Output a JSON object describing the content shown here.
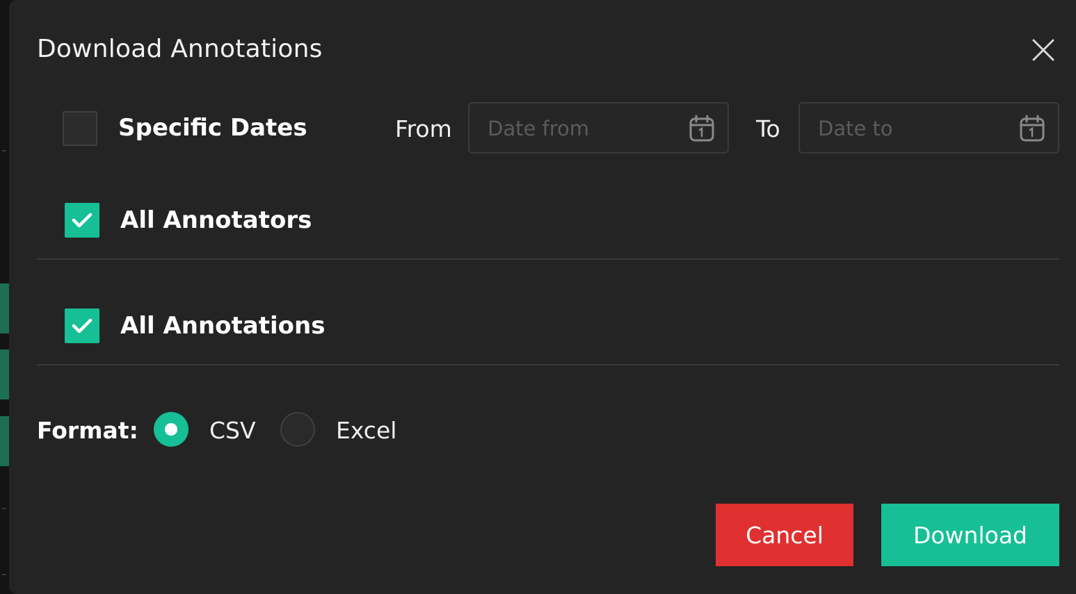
{
  "dialog": {
    "title": "Download Annotations"
  },
  "specific_dates": {
    "label": "Specific Dates",
    "checked": false,
    "from_label": "From",
    "from_placeholder": "Date from",
    "to_label": "To",
    "to_placeholder": "Date to"
  },
  "all_annotators": {
    "label": "All Annotators",
    "checked": true
  },
  "all_annotations": {
    "label": "All Annotations",
    "checked": true
  },
  "format": {
    "label": "Format:",
    "options": [
      {
        "label": "CSV",
        "selected": true
      },
      {
        "label": "Excel",
        "selected": false
      }
    ]
  },
  "actions": {
    "cancel_label": "Cancel",
    "download_label": "Download"
  },
  "colors": {
    "accent": "#16bf95",
    "danger": "#e03030",
    "surface": "#242424"
  },
  "icons": {
    "close": "close-icon",
    "calendar": "calendar-icon",
    "check": "checkmark-icon"
  }
}
